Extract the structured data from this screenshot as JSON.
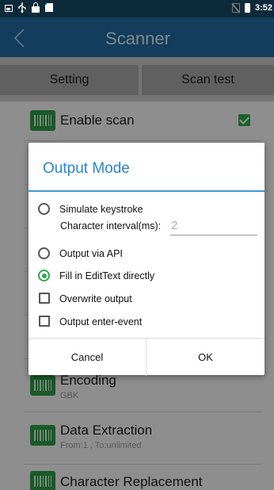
{
  "status_bar": {
    "time": "3:52"
  },
  "header": {
    "title": "Scanner"
  },
  "tabs": [
    {
      "label": "Setting"
    },
    {
      "label": "Scan test"
    }
  ],
  "settings": {
    "enable_scan": {
      "label": "Enable scan",
      "checked": true
    },
    "encoding": {
      "label": "Encoding",
      "value": "GBK"
    },
    "data_extraction": {
      "label": "Data Extraction",
      "value": "From:1 , To:unlimited"
    },
    "character_replacement": {
      "label": "Character Replacement"
    }
  },
  "dialog": {
    "title": "Output Mode",
    "options": [
      {
        "label": "Simulate keystroke",
        "type": "radio",
        "selected": false
      },
      {
        "label": "Output via API",
        "type": "radio",
        "selected": false
      },
      {
        "label": "Fill in EditText directly",
        "type": "radio",
        "selected": true
      },
      {
        "label": "Overwrite output",
        "type": "checkbox",
        "checked": false
      },
      {
        "label": "Output enter-event",
        "type": "checkbox",
        "checked": false
      }
    ],
    "interval": {
      "label": "Character interval(ms):",
      "placeholder": "2"
    },
    "cancel_label": "Cancel",
    "ok_label": "OK"
  },
  "colors": {
    "status_bar": "#0d2a3a",
    "title_bar": "#1f6aa0",
    "accent": "#2a86c8",
    "green": "#2fa94c"
  }
}
